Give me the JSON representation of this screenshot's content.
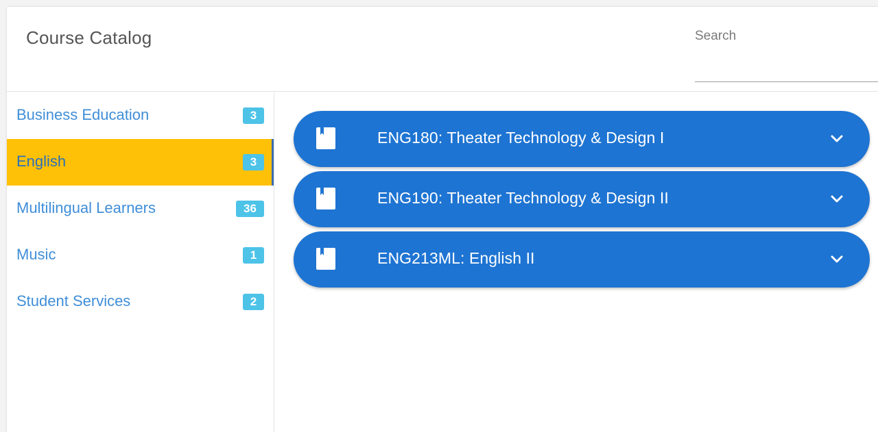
{
  "header": {
    "title": "Course Catalog",
    "search_placeholder": "Search"
  },
  "sidebar": {
    "items": [
      {
        "label": "Business Education",
        "count": "3",
        "active": false
      },
      {
        "label": "English",
        "count": "3",
        "active": true
      },
      {
        "label": "Multilingual Learners",
        "count": "36",
        "active": false
      },
      {
        "label": "Music",
        "count": "1",
        "active": false
      },
      {
        "label": "Student Services",
        "count": "2",
        "active": false
      }
    ]
  },
  "courses": [
    {
      "title": "ENG180: Theater Technology & Design I",
      "icon": "book-icon",
      "expand_icon": "chevron-down-icon"
    },
    {
      "title": "ENG190: Theater Technology & Design II",
      "icon": "book-icon",
      "expand_icon": "chevron-down-icon"
    },
    {
      "title": "ENG213ML: English II",
      "icon": "book-icon",
      "expand_icon": "chevron-down-icon"
    }
  ],
  "colors": {
    "active_category": "#ffc107",
    "course_bar": "#1e74d2",
    "badge": "#4dc3e8",
    "category_text": "#3f8ed8"
  }
}
